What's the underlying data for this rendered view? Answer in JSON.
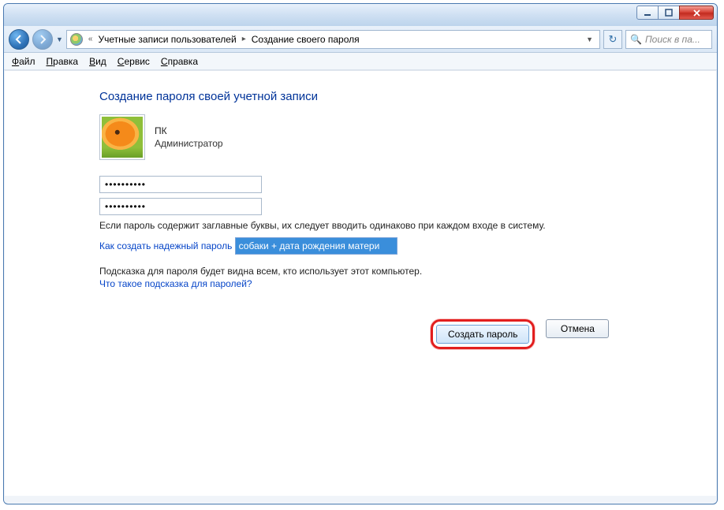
{
  "titlebar": {
    "minimize": "minimize",
    "maximize": "maximize",
    "close": "close"
  },
  "nav": {
    "breadcrumbs_prefix": "«",
    "breadcrumb1": "Учетные записи пользователей",
    "breadcrumb2": "Создание своего пароля",
    "search_placeholder": "Поиск в па..."
  },
  "menu": {
    "file": "Файл",
    "edit": "Правка",
    "view": "Вид",
    "service": "Сервис",
    "help": "Справка"
  },
  "page": {
    "title": "Создание пароля своей учетной записи",
    "user_name": "ПК",
    "user_role": "Администратор",
    "password1": "••••••••••",
    "password2": "••••••••••",
    "caps_hint": "Если пароль содержит заглавные буквы, их следует вводить одинаково при каждом входе в систему.",
    "strong_link": "Как создать надежный пароль",
    "hint_value": "собаки + дата рождения матери",
    "hint_visible_note": "Подсказка для пароля будет видна всем, кто использует этот компьютер.",
    "what_hint_link": "Что такое подсказка для паролей?",
    "create_btn": "Создать пароль",
    "cancel_btn": "Отмена"
  }
}
